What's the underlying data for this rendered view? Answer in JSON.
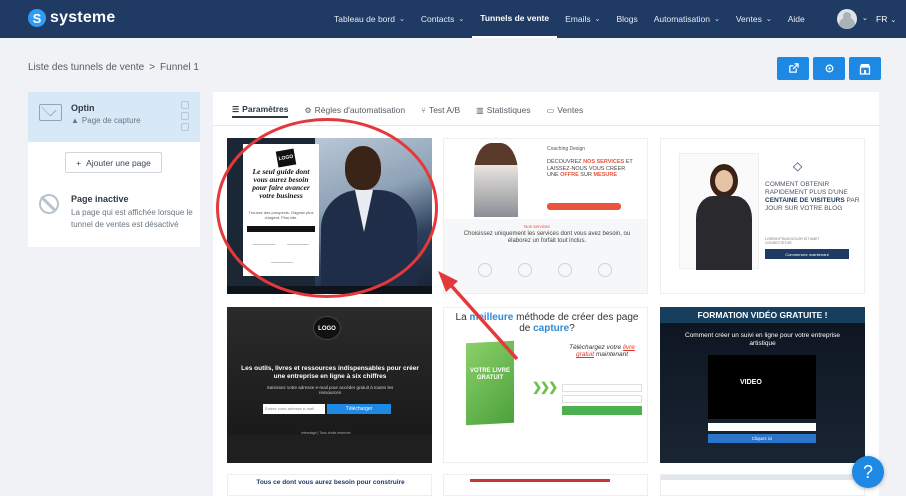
{
  "app": {
    "brand": "systeme",
    "brand_icon": "s-logo-icon",
    "nav": [
      {
        "label": "Tableau de bord",
        "dropdown": true
      },
      {
        "label": "Contacts",
        "dropdown": true
      },
      {
        "label": "Tunnels de vente",
        "dropdown": false,
        "active": true
      },
      {
        "label": "Emails",
        "dropdown": true
      },
      {
        "label": "Blogs",
        "dropdown": false
      },
      {
        "label": "Automatisation",
        "dropdown": true
      },
      {
        "label": "Ventes",
        "dropdown": true
      },
      {
        "label": "Aide",
        "dropdown": false
      }
    ],
    "language": "FR",
    "colors": {
      "navbar": "#1f3a63",
      "accent": "#1e88e5",
      "annotation": "#e5383b"
    }
  },
  "breadcrumb": {
    "parent": "Liste des tunnels de vente",
    "separator": ">",
    "current": "Funnel 1"
  },
  "top_actions": [
    "external-link-icon",
    "settings-icon",
    "shop-icon"
  ],
  "sidebar": {
    "step": {
      "name": "Optin",
      "type": "Page de capture",
      "type_icon": "warning-icon"
    },
    "add_page_label": "Ajouter une page",
    "inactive": {
      "title": "Page inactive",
      "description": "La page qui est affichée lorsque le tunnel de ventes est désactivé"
    }
  },
  "tabs": [
    {
      "label": "Paramètres",
      "icon": "list-icon",
      "active": true
    },
    {
      "label": "Règles d'automatisation",
      "icon": "gears-icon"
    },
    {
      "label": "Test A/B",
      "icon": "split-icon"
    },
    {
      "label": "Statistiques",
      "icon": "chart-icon"
    },
    {
      "label": "Ventes",
      "icon": "money-icon"
    }
  ],
  "templates": {
    "t1": {
      "logo": "LOGO",
      "headline": "Le seul guide dont vous aurez besoin pour faire avancer votre business",
      "sub": "Trouvez des prospects. Gagnez plus d'argent. Plus vite."
    },
    "t2": {
      "brand": "Coaching Design",
      "headline_a": "DÉCOUVREZ ",
      "headline_b": "NOS SERVICES",
      "headline_c": " ET LAISSEZ-NOUS VOUS CRÉER UNE ",
      "headline_d": "OFFRE",
      "headline_e": " SUR ",
      "headline_f": "MESURE",
      "label": "Nos services",
      "desc": "Choisissez uniquement les services dont vous avez besoin, ou élaborez un forfait tout inclus."
    },
    "t3": {
      "line_a": "Comment obtenir rapidement plus d'une ",
      "line_b": "centaine de visiteurs",
      "line_c": " par jour sur votre blog",
      "small": "LOREM IPSUM DOLOR SIT AMET CONSECTETUR",
      "button": "Commencez maintenant"
    },
    "t4": {
      "logo": "LOGO",
      "headline": "Les outils, livres et ressources indispensables pour créer une entreprise en ligne à six chiffres",
      "sub": "Saisissez votre adresse e-mail pour accéder gratuit à toutes les ressources",
      "placeholder": "Entrez votre adresse e-mail",
      "button": "Télécharger",
      "footer": "Interstage | Tous droits réservés"
    },
    "t5": {
      "headline_a": "La ",
      "headline_b": "meilleure",
      "headline_c": " méthode de créer des page de ",
      "headline_d": "capture",
      "headline_e": "?",
      "book": "VOTRE LIVRE GRATUIT",
      "form_title_a": "Téléchargez votre ",
      "form_title_b": "livre gratuit",
      "form_title_c": " maintenant"
    },
    "t6": {
      "banner": "FORMATION VIDÉO GRATUITE !",
      "headline": "Comment créer un suivi en ligne pour votre entreprise artistique",
      "video_label": "VIDEO",
      "button": "Cliquez ici"
    },
    "t7": {
      "headline": "Tous ce dont vous aurez besoin pour construire"
    }
  },
  "help_label": "?"
}
